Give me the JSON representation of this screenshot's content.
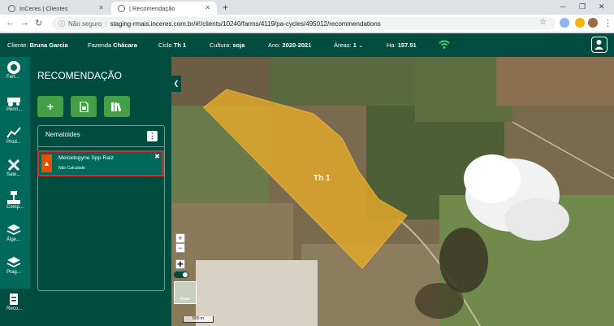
{
  "browser": {
    "tabs": [
      {
        "title": "InCeres | Clientes",
        "active": false
      },
      {
        "title": "| Recomendação",
        "active": true
      }
    ],
    "security_label": "Não seguro",
    "url": "staging-rmais.inceres.com.br/#!/clients/10240/farms/4119/pa-cycles/495012/recommendations"
  },
  "header": {
    "cliente_label": "Cliente:",
    "cliente_value": "Bruna Garcia",
    "fazenda_label": "Fazenda",
    "fazenda_value": "Chácara",
    "ciclo_label": "Ciclo",
    "ciclo_value": "Th 1",
    "cultura_label": "Cultura:",
    "cultura_value": "soja",
    "ano_label": "Ano:",
    "ano_value": "2020-2021",
    "areas_label": "Áreas:",
    "areas_value": "1",
    "ha_label": "Ha:",
    "ha_value": "157.51"
  },
  "rail": {
    "items": [
      {
        "label": "Fert...",
        "icon": "fertilizer-icon"
      },
      {
        "label": "Perm...",
        "icon": "tractor-icon"
      },
      {
        "label": "Prod...",
        "icon": "chart-icon"
      },
      {
        "label": "Sate...",
        "icon": "satellite-icon"
      },
      {
        "label": "Comp...",
        "icon": "compaction-icon"
      },
      {
        "label": "Álge...",
        "icon": "layers-icon"
      },
      {
        "label": "Prag...",
        "icon": "layers-icon"
      },
      {
        "label": "Reco...",
        "icon": "recommendation-icon"
      }
    ]
  },
  "panel": {
    "title": "RECOMENDAÇÃO",
    "add_label": "+",
    "nematoides_title": "Nematoides",
    "kebab": "⋮",
    "item": {
      "name": "Meloidogyne Spp Raiz",
      "status": "Não Calculado",
      "warn": "▲",
      "close": "✖"
    }
  },
  "map": {
    "field_label": "Th 1",
    "zoom_in": "+",
    "zoom_out": "−",
    "scale": "500 m",
    "thumb_label": "Mapa"
  }
}
